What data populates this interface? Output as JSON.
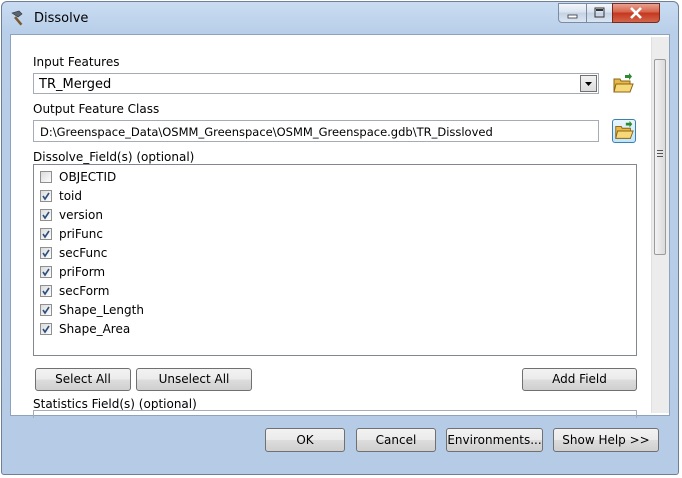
{
  "window": {
    "title": "Dissolve"
  },
  "input_features": {
    "label": "Input Features",
    "value": "TR_Merged"
  },
  "output_feature_class": {
    "label": "Output Feature Class",
    "value": "D:\\Greenspace_Data\\OSMM_Greenspace\\OSMM_Greenspace.gdb\\TR_Dissloved"
  },
  "dissolve_fields": {
    "label": "Dissolve_Field(s) (optional)",
    "items": [
      {
        "label": "OBJECTID",
        "checked": false
      },
      {
        "label": "toid",
        "checked": true
      },
      {
        "label": "version",
        "checked": true
      },
      {
        "label": "priFunc",
        "checked": true
      },
      {
        "label": "secFunc",
        "checked": true
      },
      {
        "label": "priForm",
        "checked": true
      },
      {
        "label": "secForm",
        "checked": true
      },
      {
        "label": "Shape_Length",
        "checked": true
      },
      {
        "label": "Shape_Area",
        "checked": true
      }
    ]
  },
  "list_buttons": {
    "select_all": "Select All",
    "unselect_all": "Unselect All",
    "add_field": "Add Field"
  },
  "statistics_fields": {
    "label": "Statistics Field(s) (optional)"
  },
  "dialog_buttons": {
    "ok": "OK",
    "cancel": "Cancel",
    "environments": "Environments...",
    "show_help": "Show Help >>"
  },
  "icons": {
    "title": "hammer-icon",
    "browse": "folder-open-icon"
  }
}
